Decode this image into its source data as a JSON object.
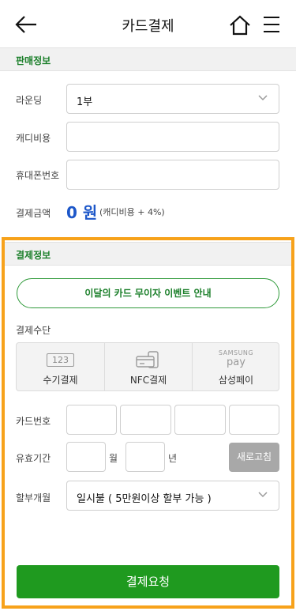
{
  "header": {
    "title": "카드결제"
  },
  "sales_info": {
    "section_title": "판매정보",
    "round_label": "라운딩",
    "round_value": "1부",
    "caddie_fee_label": "캐디비용",
    "caddie_fee_value": "",
    "phone_label": "휴대폰번호",
    "phone_value": "",
    "amount_label": "결제금액",
    "amount_value": "0 원",
    "amount_note": "(캐디비용 + 4%)"
  },
  "payment_info": {
    "section_title": "결제정보",
    "event_button": "이달의 카드 무이자 이벤트 안내",
    "method_label": "결제수단",
    "methods": [
      {
        "label": "수기결제",
        "icon": "keypad-123-icon",
        "icon_text": "123"
      },
      {
        "label": "NFC결제",
        "icon": "nfc-card-icon"
      },
      {
        "label": "삼성페이",
        "icon": "samsung-pay-logo",
        "logo_top": "SAMSUNG",
        "logo_bottom": "pay"
      }
    ],
    "card_number_label": "카드번호",
    "expiry_label": "유효기간",
    "month_unit": "월",
    "year_unit": "년",
    "refresh_button": "새로고침",
    "installment_label": "할부개월",
    "installment_value": "일시불 ( 5만원이상 할부 가능 )"
  },
  "submit_button": "결제요청",
  "colors": {
    "accent_green": "#1f9a1f",
    "highlight_orange": "#f7a21b",
    "amount_blue": "#1d57c9"
  }
}
